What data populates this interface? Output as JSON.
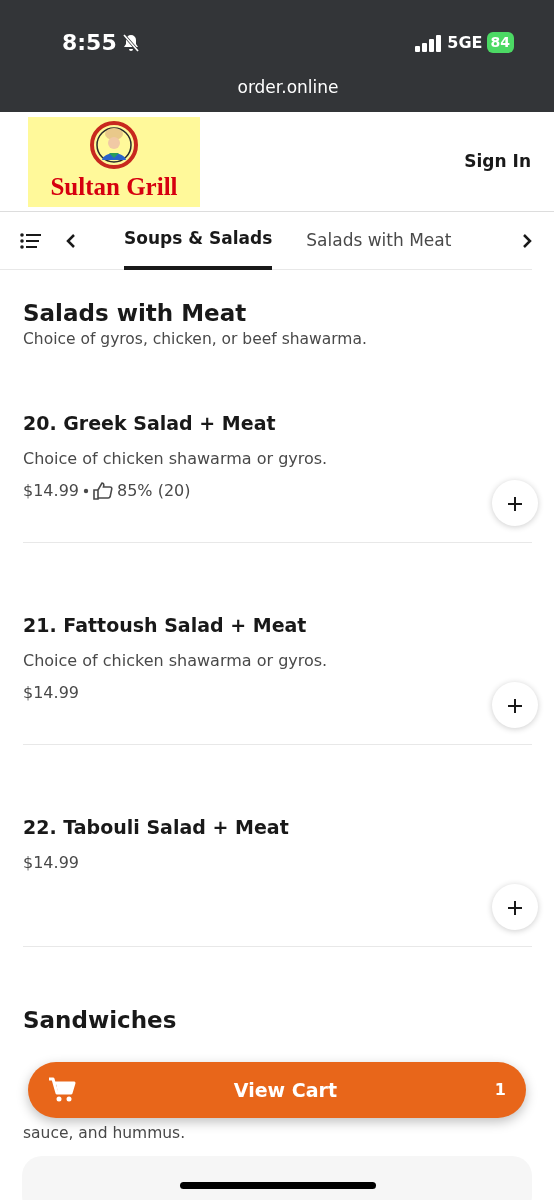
{
  "status_bar": {
    "time": "8:55",
    "network": "5GE",
    "battery": "84",
    "url": "order.online"
  },
  "header": {
    "logo_text": "Sultan Grill",
    "sign_in": "Sign In"
  },
  "category_tabs": [
    {
      "label": "Soups & Salads",
      "selected": true
    },
    {
      "label": "Salads with Meat",
      "selected": false
    }
  ],
  "section": {
    "title": "Salads with Meat",
    "description": "Choice of gyros, chicken, or beef shawarma."
  },
  "items": [
    {
      "name": "20. Greek Salad + Meat",
      "description": "Choice of chicken shawarma or gyros.",
      "price": "$14.99",
      "rating": "85% (20)"
    },
    {
      "name": "21. Fattoush Salad + Meat",
      "description": "Choice of chicken shawarma or gyros.",
      "price": "$14.99"
    },
    {
      "name": "22. Tabouli Salad + Meat",
      "price": "$14.99"
    }
  ],
  "next_section": {
    "title": "Sandwiches",
    "description_tail": "sauce, and hummus."
  },
  "cart": {
    "label": "View Cart",
    "count": "1"
  }
}
